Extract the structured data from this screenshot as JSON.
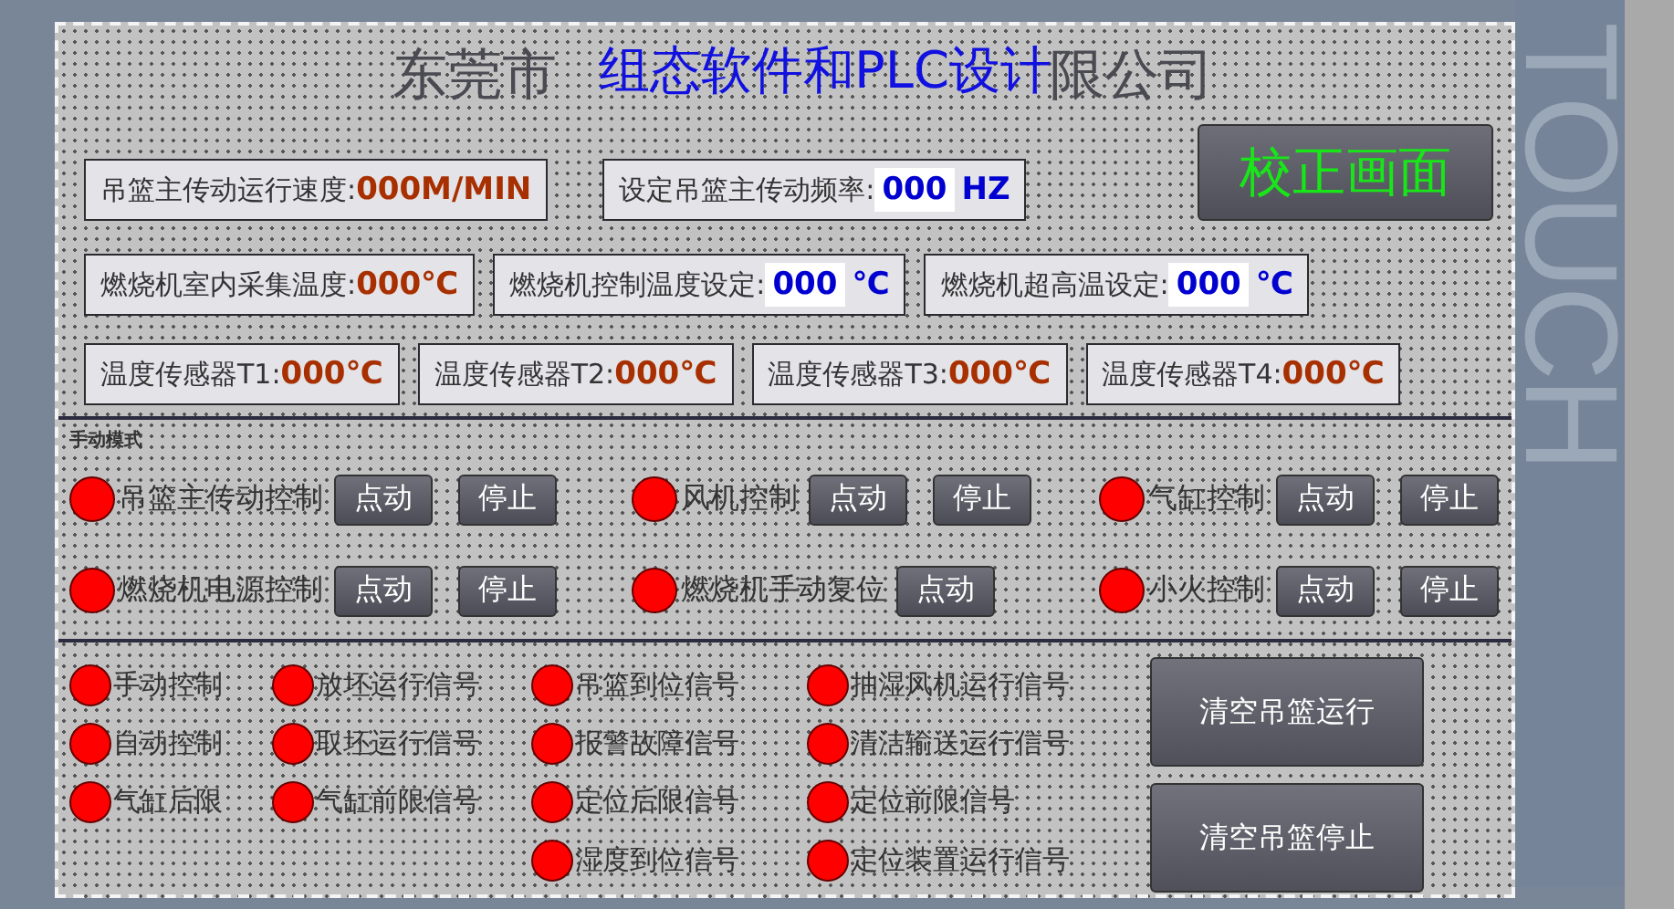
{
  "title": {
    "under_left": "东莞市",
    "under_right": "限公司",
    "overlay": "组态软件和PLC设计"
  },
  "side_label": "TOUCH",
  "calibrate_button": "校正画面",
  "field_rows": [
    [
      {
        "label": "吊篮主传动运行速度:",
        "kind": "display",
        "value": "000M/MIN"
      },
      {
        "label": "设定吊篮主传动频率:",
        "kind": "setting",
        "value": "000",
        "unit": "HZ"
      }
    ],
    [
      {
        "label": "燃烧机室内采集温度:",
        "kind": "display",
        "value": "000℃"
      },
      {
        "label": "燃烧机控制温度设定:",
        "kind": "setting",
        "value": "000",
        "unit": "℃"
      },
      {
        "label": "燃烧机超高温设定:",
        "kind": "setting",
        "value": "000",
        "unit": "℃"
      }
    ],
    [
      {
        "label": "温度传感器T1:",
        "kind": "display",
        "value": "000℃"
      },
      {
        "label": "温度传感器T2:",
        "kind": "display",
        "value": "000℃"
      },
      {
        "label": "温度传感器T3:",
        "kind": "display",
        "value": "000℃"
      },
      {
        "label": "温度传感器T4:",
        "kind": "display",
        "value": "000℃"
      }
    ]
  ],
  "manual_mode_label": "手动模式",
  "manual_controls": [
    {
      "label": "吊篮主传动控制",
      "on": true,
      "buttons": [
        "点动",
        "停止"
      ]
    },
    {
      "label": "风机控制",
      "on": true,
      "buttons": [
        "点动",
        "停止"
      ]
    },
    {
      "label": "气缸控制",
      "on": true,
      "buttons": [
        "点动",
        "停止"
      ]
    },
    {
      "label": "燃烧机电源控制",
      "on": true,
      "buttons": [
        "点动",
        "停止"
      ]
    },
    {
      "label": "燃烧机手动复位",
      "on": true,
      "buttons": [
        "点动"
      ]
    },
    {
      "label": "小火控制",
      "on": true,
      "buttons": [
        "点动",
        "停止"
      ]
    }
  ],
  "signal_columns": [
    [
      {
        "label": "手动控制",
        "on": true
      },
      {
        "label": "自动控制",
        "on": true
      },
      {
        "label": "气缸后限",
        "on": true
      }
    ],
    [
      {
        "label": "放坯运行信号",
        "on": true
      },
      {
        "label": "取坯运行信号",
        "on": true
      },
      {
        "label": "气缸前限信号",
        "on": true
      }
    ],
    [
      {
        "label": "吊篮到位信号",
        "on": true
      },
      {
        "label": "报警故障信号",
        "on": true
      },
      {
        "label": "定位后限信号",
        "on": true
      },
      {
        "label": "湿度到位信号",
        "on": true
      }
    ],
    [
      {
        "label": "抽湿风机运行信号",
        "on": true
      },
      {
        "label": "清洁输送运行信号",
        "on": true
      },
      {
        "label": "定位前限信号",
        "on": true
      },
      {
        "label": "定位装置运行信号",
        "on": true
      }
    ]
  ],
  "big_buttons": [
    "清空吊篮运行",
    "清空吊篮停止"
  ]
}
